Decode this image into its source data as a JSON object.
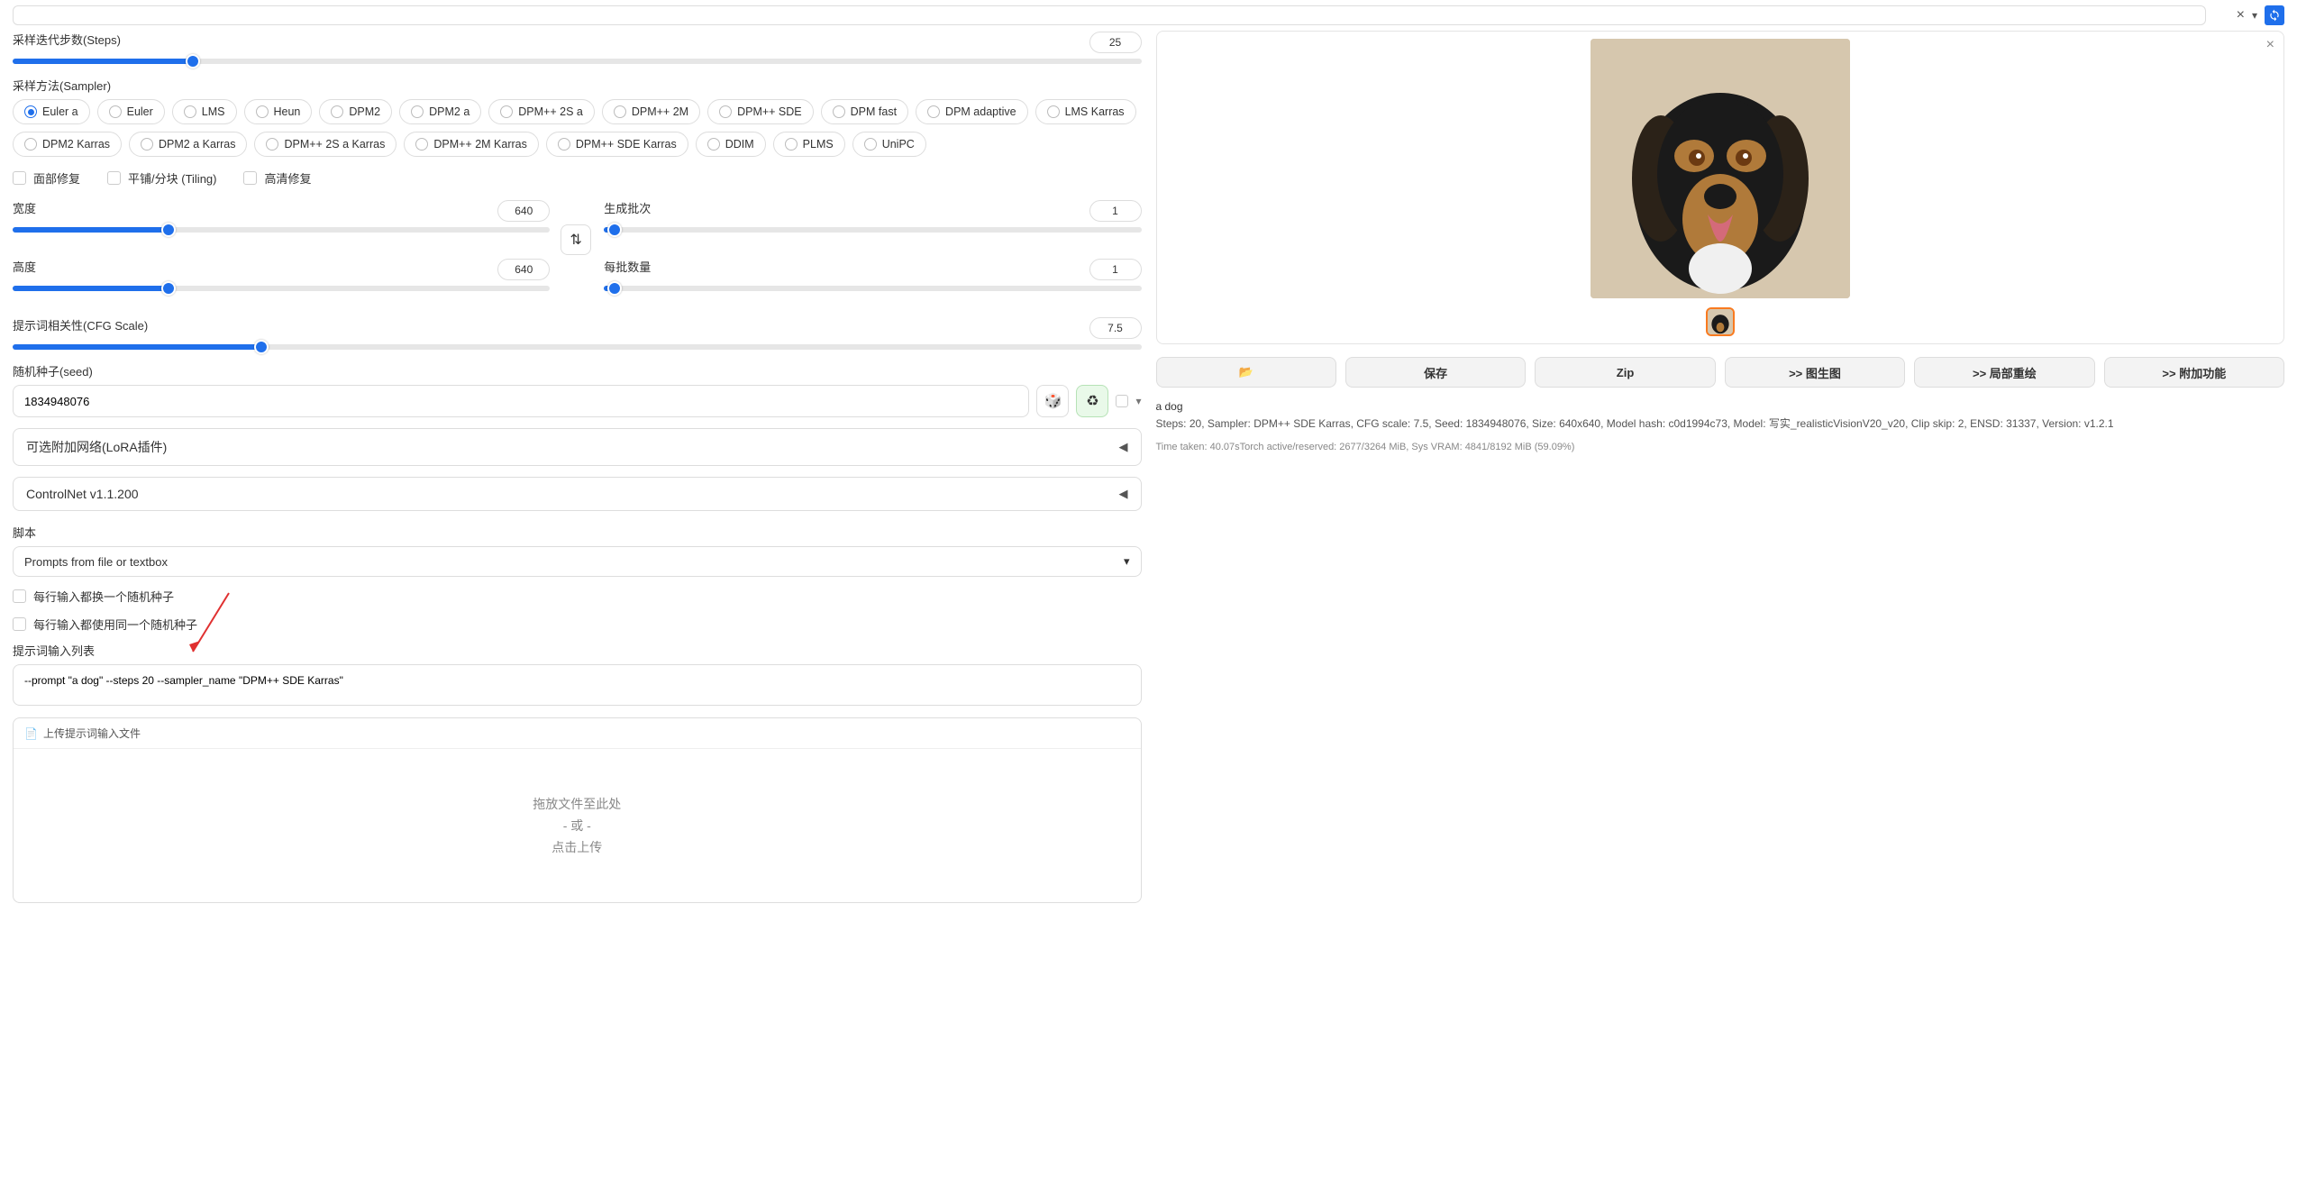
{
  "steps": {
    "label": "采样迭代步数(Steps)",
    "value": "25",
    "pct": 16
  },
  "sampler": {
    "label": "采样方法(Sampler)",
    "selected": "Euler a",
    "options": [
      "Euler a",
      "Euler",
      "LMS",
      "Heun",
      "DPM2",
      "DPM2 a",
      "DPM++ 2S a",
      "DPM++ 2M",
      "DPM++ SDE",
      "DPM fast",
      "DPM adaptive",
      "LMS Karras",
      "DPM2 Karras",
      "DPM2 a Karras",
      "DPM++ 2S a Karras",
      "DPM++ 2M Karras",
      "DPM++ SDE Karras",
      "DDIM",
      "PLMS",
      "UniPC"
    ]
  },
  "checks": {
    "restore_faces": "面部修复",
    "tiling": "平铺/分块 (Tiling)",
    "hires": "高清修复"
  },
  "width": {
    "label": "宽度",
    "value": "640",
    "pct": 29
  },
  "height": {
    "label": "高度",
    "value": "640",
    "pct": 29
  },
  "batch_count": {
    "label": "生成批次",
    "value": "1",
    "pct": 2
  },
  "batch_size": {
    "label": "每批数量",
    "value": "1",
    "pct": 2
  },
  "swap_icon": "⇅",
  "cfg": {
    "label": "提示词相关性(CFG Scale)",
    "value": "7.5",
    "pct": 22
  },
  "seed": {
    "label": "随机种子(seed)",
    "value": "1834948076",
    "dice_icon": "🎲",
    "recycle_icon": "♻"
  },
  "accordions": {
    "lora": "可选附加网络(LoRA插件)",
    "controlnet": "ControlNet v1.1.200"
  },
  "script": {
    "label": "脚本",
    "selected": "Prompts from file or textbox",
    "opt_random_seed_each": "每行输入都换一个随机种子",
    "opt_same_seed_each": "每行输入都使用同一个随机种子",
    "list_label": "提示词输入列表",
    "list_value": "--prompt \"a dog\" --steps 20 --sampler_name \"DPM++ SDE Karras\"",
    "upload_tab": "上传提示词输入文件",
    "upload_icon": "📄",
    "drop_line1": "拖放文件至此处",
    "drop_line2": "- 或 -",
    "drop_line3": "点击上传"
  },
  "output": {
    "buttons": {
      "folder_icon": "📂",
      "save": "保存",
      "zip": "Zip",
      "img2img": ">> 图生图",
      "inpaint": ">> 局部重绘",
      "extras": ">> 附加功能"
    },
    "prompt_echo": "a dog",
    "meta": "Steps: 20, Sampler: DPM++ SDE Karras, CFG scale: 7.5, Seed: 1834948076, Size: 640x640, Model hash: c0d1994c73, Model: 写实_realisticVisionV20_v20, Clip skip: 2, ENSD: 31337, Version: v1.2.1",
    "time": "Time taken: 40.07sTorch active/reserved: 2677/3264 MiB, Sys VRAM: 4841/8192 MiB (59.09%)"
  }
}
